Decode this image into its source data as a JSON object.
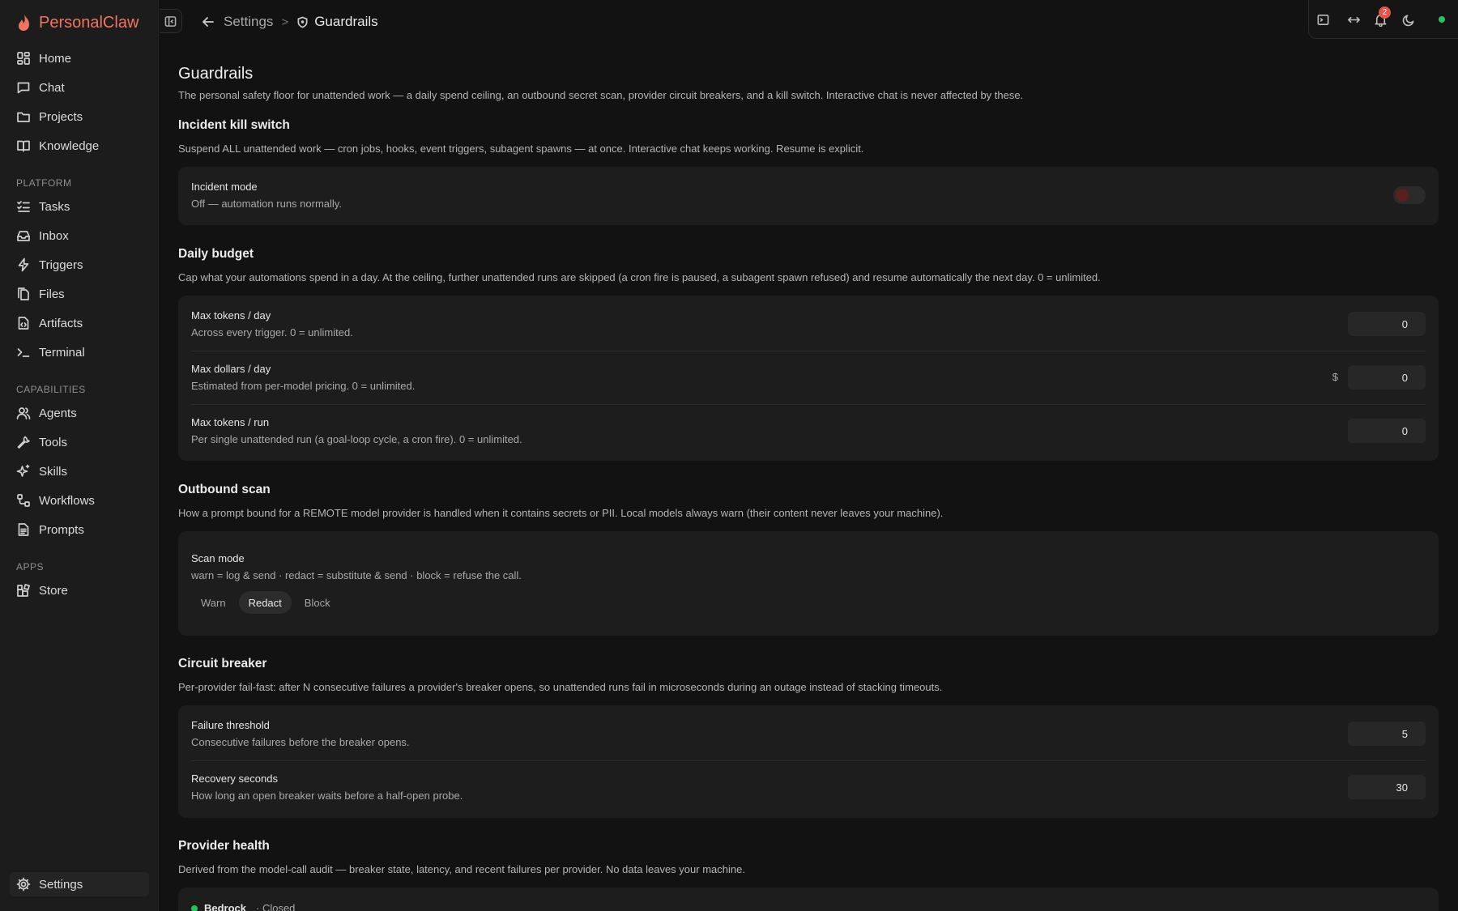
{
  "brand": {
    "name": "PersonalClaw",
    "color": "#ef7561"
  },
  "sidebar": {
    "primary": [
      {
        "label": "Home",
        "icon": "home-grid-icon"
      },
      {
        "label": "Chat",
        "icon": "chat-icon"
      },
      {
        "label": "Projects",
        "icon": "folder-icon"
      },
      {
        "label": "Knowledge",
        "icon": "book-icon"
      }
    ],
    "platform_label": "PLATFORM",
    "platform": [
      {
        "label": "Tasks",
        "icon": "tasks-icon"
      },
      {
        "label": "Inbox",
        "icon": "inbox-icon"
      },
      {
        "label": "Triggers",
        "icon": "lightning-icon"
      },
      {
        "label": "Files",
        "icon": "files-icon"
      },
      {
        "label": "Artifacts",
        "icon": "artifact-icon"
      },
      {
        "label": "Terminal",
        "icon": "terminal-icon"
      }
    ],
    "capabilities_label": "CAPABILITIES",
    "capabilities": [
      {
        "label": "Agents",
        "icon": "users-icon"
      },
      {
        "label": "Tools",
        "icon": "wrench-icon"
      },
      {
        "label": "Skills",
        "icon": "sparkles-icon"
      },
      {
        "label": "Workflows",
        "icon": "workflow-icon"
      },
      {
        "label": "Prompts",
        "icon": "document-icon"
      }
    ],
    "apps_label": "APPS",
    "apps": [
      {
        "label": "Store",
        "icon": "store-icon"
      }
    ],
    "settings": {
      "label": "Settings",
      "icon": "gear-icon"
    }
  },
  "header": {
    "breadcrumb_parent": "Settings",
    "breadcrumb_separator": ">",
    "breadcrumb_current": "Guardrails",
    "notification_count": "2",
    "status_color": "#22c55e"
  },
  "page": {
    "title": "Guardrails",
    "description": "The personal safety floor for unattended work — a daily spend ceiling, an outbound secret scan, provider circuit breakers, and a kill switch. Interactive chat is never affected by these."
  },
  "kill_switch": {
    "title": "Incident kill switch",
    "description": "Suspend ALL unattended work — cron jobs, hooks, event triggers, subagent spawns — at once. Interactive chat keeps working. Resume is explicit.",
    "label": "Incident mode",
    "status": "Off — automation runs normally.",
    "enabled": false
  },
  "budget": {
    "title": "Daily budget",
    "description": "Cap what your automations spend in a day. At the ceiling, further unattended runs are skipped (a cron fire is paused, a subagent spawn refused) and resume automatically the next day. 0 = unlimited.",
    "rows": [
      {
        "label": "Max tokens / day",
        "sub": "Across every trigger. 0 = unlimited.",
        "value": "0"
      },
      {
        "label": "Max dollars / day",
        "sub": "Estimated from per-model pricing. 0 = unlimited.",
        "prefix": "$",
        "value": "0"
      },
      {
        "label": "Max tokens / run",
        "sub": "Per single unattended run (a goal-loop cycle, a cron fire). 0 = unlimited.",
        "value": "0"
      }
    ]
  },
  "outbound": {
    "title": "Outbound scan",
    "description": "How a prompt bound for a REMOTE model provider is handled when it contains secrets or PII. Local models always warn (their content never leaves your machine).",
    "label": "Scan mode",
    "sub": "warn = log & send · redact = substitute & send · block = refuse the call.",
    "options": [
      "Warn",
      "Redact",
      "Block"
    ],
    "selected": "Redact"
  },
  "breaker": {
    "title": "Circuit breaker",
    "description": "Per-provider fail-fast: after N consecutive failures a provider's breaker opens, so unattended runs fail in microseconds during an outage instead of stacking timeouts.",
    "rows": [
      {
        "label": "Failure threshold",
        "sub": "Consecutive failures before the breaker opens.",
        "value": "5"
      },
      {
        "label": "Recovery seconds",
        "sub": "How long an open breaker waits before a half-open probe.",
        "value": "30"
      }
    ]
  },
  "health": {
    "title": "Provider health",
    "description": "Derived from the model-call audit — breaker state, latency, and recent failures per provider. No data leaves your machine.",
    "first_provider": "Bedrock",
    "first_state": "· Closed"
  }
}
